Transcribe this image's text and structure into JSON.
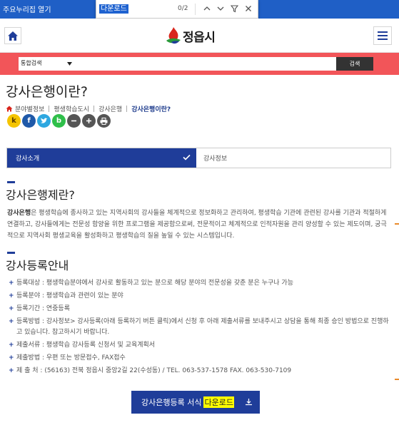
{
  "browser": {
    "skip_link": "주요누리집 열기",
    "find": {
      "query": "다운로드",
      "count": "0/2"
    }
  },
  "header": {
    "logo_text": "정읍시"
  },
  "search": {
    "scope": "통합검색",
    "button": "검색"
  },
  "page": {
    "title": "강사은행이란?"
  },
  "breadcrumb": [
    "분야별정보",
    "평생학습도시",
    "강사은행",
    "강사은행이란?"
  ],
  "share": [
    "kakaostory-icon",
    "facebook-icon",
    "twitter-icon",
    "band-icon",
    "zoom-out-icon",
    "zoom-in-icon",
    "print-icon"
  ],
  "tabs": [
    {
      "label": "강사소개",
      "active": true
    },
    {
      "label": "강사정보",
      "active": false
    }
  ],
  "section1": {
    "heading": "강사은행제란?",
    "lead": "강사은행",
    "text": "은 평생학습에 종사하고 있는 지역사회의 강사들을 체계적으로 정보화하고 관리하여, 평생학습 기관에 관련된 강사를 기관과 적절하게 연결하고, 강사들에게는 전문성 함양을 위한 프로그램을 제공함으로써, 전문적이고 체계적으로 인적자원을 관리 양성할 수 있는 제도이며, 궁극적으로 지역사회 평생교육을 활성화하고 평생학습의 질을 높일 수 있는 시스템입니다."
  },
  "section2": {
    "heading": "강사등록안내",
    "items": [
      "등록대상 : 평생학습분야에서 강사로 활동하고 있는 분으로 해당 분야의 전문성을 갖춘 분은 누구나 가능",
      "등록분야 : 평생학습과 관련이 있는 분야",
      "등록기간 : 연중등록",
      "등록방법 : 강사정보> 강사등록(아래 등록하기 버튼 클릭)에서 신청 후 아래 제출서류를 보내주시고 상담을 통해 최종 승인 방법으로 진행하고 있습니다. 참고하시기 바랍니다.",
      "제출서류 : 평생학습 강사등록 신청서 및 교육계획서",
      "제출방법 : 우편 또는 방문접수, FAX접수",
      "제 출 처 : (56163) 전북 정읍시 중앙2길 22(수성동) / TEL. 063-537-1578 FAX. 063-530-7109"
    ]
  },
  "download": {
    "label": "강사은행등록 서식",
    "highlight": "다운로드"
  },
  "colors": {
    "accent": "#1f3d99",
    "search_band": "#f25559",
    "find_highlight": "#ffff00"
  }
}
